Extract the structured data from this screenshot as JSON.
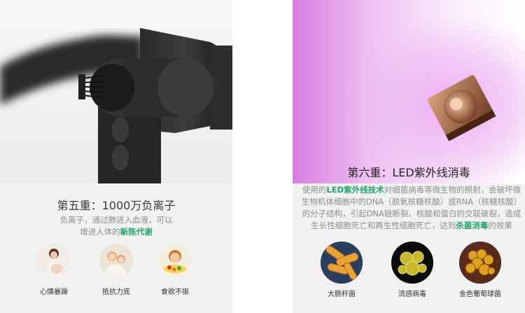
{
  "left": {
    "title": "第五重：1000万负离子",
    "desc_part1": "负离子，通过肺进入血液，可以",
    "desc_part2": "增进人体的",
    "desc_highlight": "新陈代谢",
    "icons": [
      {
        "label": "心情暴躁",
        "icon": "pregnant-woman-icon"
      },
      {
        "label": "抵抗力底",
        "icon": "mother-child-icon"
      },
      {
        "label": "食欲不振",
        "icon": "child-eating-icon"
      }
    ]
  },
  "right": {
    "title": "第六重：LED紫外线消毒",
    "desc_pre": "使用的",
    "desc_hl1": "LED紫外线技术",
    "desc_mid": "对细菌病毒等微生物的照射，会破坏微生物机体细胞中的DNA（脱氧核糖核酸）或RNA（核糖核酸）的分子结构，引起DNA链断裂、核酸和蛋白的交联破裂，造成生长性细胞死亡和再生性细胞死亡，达到",
    "desc_hl2": "杀菌消毒",
    "desc_post": "的效果",
    "bacteria": [
      {
        "label": "大肠杆菌",
        "icon": "e-coli-icon"
      },
      {
        "label": "流感病毒",
        "icon": "influenza-virus-icon"
      },
      {
        "label": "金色葡萄球菌",
        "icon": "staphylococcus-icon"
      }
    ]
  },
  "colors": {
    "highlight": "#23a56a",
    "red_highlight": "#c0392b",
    "uv_purple": "#d67ee0"
  }
}
